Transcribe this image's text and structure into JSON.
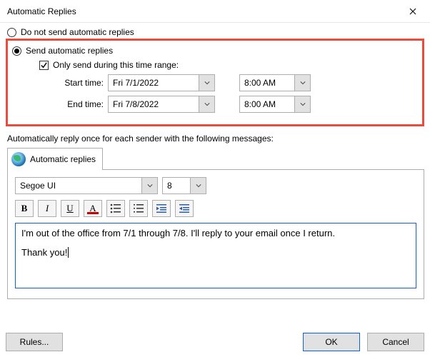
{
  "titlebar": {
    "title": "Automatic Replies"
  },
  "radios": {
    "off_label": "Do not send automatic replies",
    "on_label": "Send automatic replies"
  },
  "timerange": {
    "checkbox_label": "Only send during this time range:",
    "start_label": "Start time:",
    "end_label": "End time:",
    "start_date": "Fri 7/1/2022",
    "start_time": "8:00 AM",
    "end_date": "Fri 7/8/2022",
    "end_time": "8:00 AM"
  },
  "section_label": "Automatically reply once for each sender with the following messages:",
  "tab": {
    "label": "Automatic replies"
  },
  "format": {
    "font_name": "Segoe UI",
    "font_size": "8"
  },
  "toolbar": {
    "bold": "B",
    "italic": "I",
    "underline": "U",
    "font_color": "A"
  },
  "editor": {
    "line1": "I'm out of the office from 7/1 through 7/8. I'll reply to your email once I return.",
    "line2": "Thank you!"
  },
  "buttons": {
    "rules": "Rules...",
    "ok": "OK",
    "cancel": "Cancel"
  }
}
